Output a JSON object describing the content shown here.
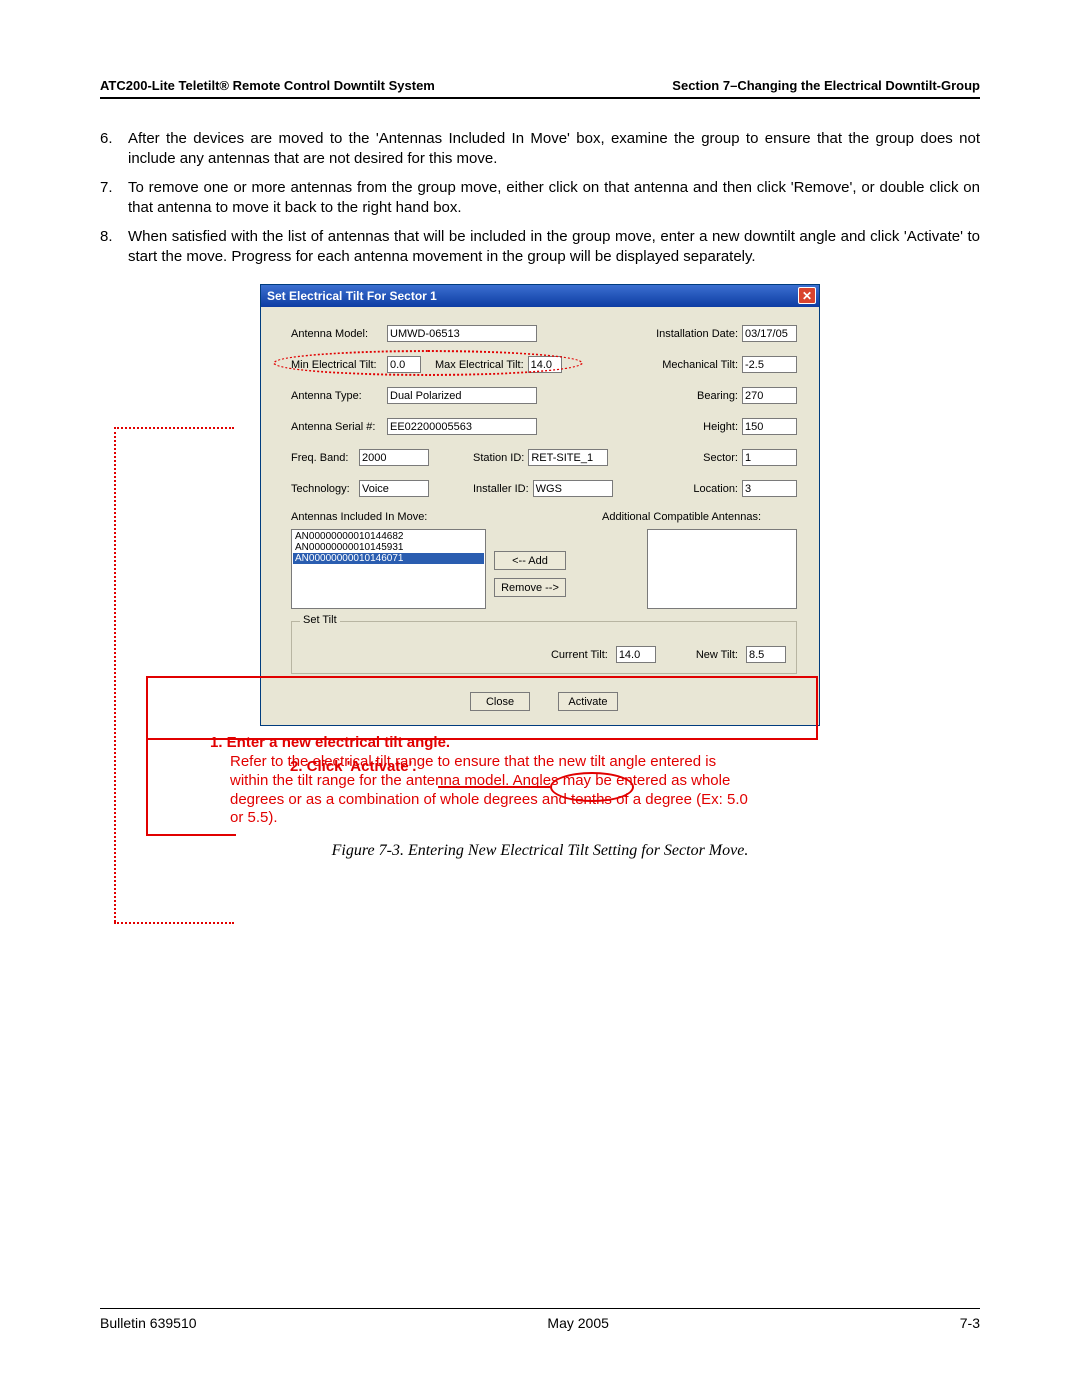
{
  "header": {
    "left": "ATC200-Lite Teletilt® Remote Control Downtilt System",
    "right": "Section 7–Changing the Electrical Downtilt-Group"
  },
  "steps": {
    "s6_num": "6.",
    "s6": "After the devices are moved to the 'Antennas Included In Move' box, examine the group to ensure that the group does not include any antennas that are not desired for this move.",
    "s7_num": "7.",
    "s7": "To remove one or more antennas from the group move, either click on that antenna and then click 'Remove', or double click on that antenna to move it back to the right hand box.",
    "s8_num": "8.",
    "s8": "When satisfied with the list of antennas that will be included in the group move, enter a new downtilt angle and click 'Activate' to start the move. Progress for each antenna movement in the group will be displayed separately."
  },
  "dlg": {
    "title": "Set Electrical Tilt For Sector 1",
    "labels": {
      "antenna_model": "Antenna Model:",
      "install_date": "Installation Date:",
      "min_tilt": "Min Electrical Tilt:",
      "max_tilt": "Max Electrical Tilt:",
      "mech_tilt": "Mechanical Tilt:",
      "antenna_type": "Antenna Type:",
      "bearing": "Bearing:",
      "serial": "Antenna Serial #:",
      "height": "Height:",
      "freq": "Freq. Band:",
      "station": "Station ID:",
      "sector": "Sector:",
      "tech": "Technology:",
      "installer": "Installer ID:",
      "location": "Location:",
      "list_left": "Antennas Included In Move:",
      "list_right": "Additional Compatible Antennas:",
      "add_btn": "<-- Add",
      "remove_btn": "Remove -->",
      "set_tilt_legend": "Set Tilt",
      "current_tilt": "Current Tilt:",
      "new_tilt": "New Tilt:",
      "close_btn": "Close",
      "activate_btn": "Activate"
    },
    "values": {
      "antenna_model": "UMWD-06513",
      "install_date": "03/17/05",
      "min_tilt": "0.0",
      "max_tilt": "14.0",
      "mech_tilt": "-2.5",
      "antenna_type": "Dual Polarized",
      "bearing": "270",
      "serial": "EE02200005563",
      "height": "150",
      "freq": "2000",
      "station": "RET-SITE_1",
      "sector": "1",
      "tech": "Voice",
      "installer": "WGS",
      "location": "3",
      "current_tilt": "14.0",
      "new_tilt": "8.5"
    },
    "included": [
      "AN00000000010144682",
      "AN00000000010145931",
      "AN00000000010146071"
    ]
  },
  "annotations": {
    "callout2": "2.  Click 'Activate'.",
    "callout1": "1.  Enter a new electrical tilt angle.",
    "note": "Refer to the electrical tilt range to ensure that the new tilt angle entered is within the tilt range for the antenna model. Angles may be entered as whole degrees or as a combination of whole degrees and tenths of a degree (Ex: 5.0 or 5.5)."
  },
  "figure_caption": "Figure 7-3. Entering New Electrical Tilt Setting for Sector Move.",
  "footer": {
    "left": "Bulletin 639510",
    "center": "May 2005",
    "right": "7-3"
  }
}
